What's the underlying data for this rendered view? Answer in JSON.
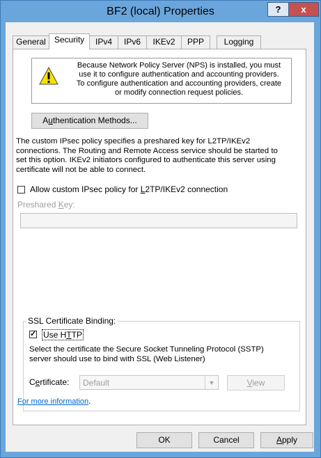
{
  "window": {
    "title": "BF2 (local) Properties",
    "help_label": "?",
    "close_label": "x"
  },
  "tabs": [
    {
      "label": "General",
      "active": false
    },
    {
      "label": "Security",
      "active": true
    },
    {
      "label": "IPv4",
      "active": false
    },
    {
      "label": "IPv6",
      "active": false
    },
    {
      "label": "IKEv2",
      "active": false
    },
    {
      "label": "PPP",
      "active": false
    },
    {
      "label": "Logging",
      "active": false
    }
  ],
  "notice": {
    "icon": "warning-icon",
    "lines": [
      "Because Network Policy Server (NPS) is installed, you must",
      "use it to configure authentication and accounting providers.",
      "To configure authentication and accounting providers, create",
      "or modify connection request policies."
    ]
  },
  "auth_button": {
    "pre": "A",
    "accel": "u",
    "post": "thentication Methods..."
  },
  "description": {
    "lines": [
      "The custom IPsec policy specifies a preshared key for L2TP/IKEv2",
      "connections. The Routing and Remote Access service should be started to",
      "set this option. IKEv2 initiators configured to authenticate this server using",
      "certificate will not be able to connect."
    ]
  },
  "custom_policy": {
    "pre": "Allow custom IPsec policy for ",
    "accel": "L",
    "post": "2TP/IKEv2 connection",
    "checked": false
  },
  "preshared_key": {
    "pre": "Preshared ",
    "accel": "K",
    "post": "ey:",
    "value": ""
  },
  "ssl_group": {
    "title": "SSL Certificate Binding:",
    "use_http": {
      "pre": "Use H",
      "accel": "T",
      "post": "TP",
      "checked": true
    },
    "description": [
      "Select the certificate the Secure Socket Tunneling Protocol (SSTP)",
      "server should use to bind with SSL (Web Listener)"
    ],
    "certificate": {
      "pre": "C",
      "accel": "e",
      "post": "rtificate:",
      "value": "Default"
    },
    "view_button": {
      "pre": "",
      "accel": "V",
      "post": "iew"
    }
  },
  "more_info_link": "For more information",
  "more_info_suffix": ".",
  "buttons": {
    "ok": "OK",
    "cancel": "Cancel",
    "apply": {
      "pre": "",
      "accel": "A",
      "post": "pply"
    }
  }
}
